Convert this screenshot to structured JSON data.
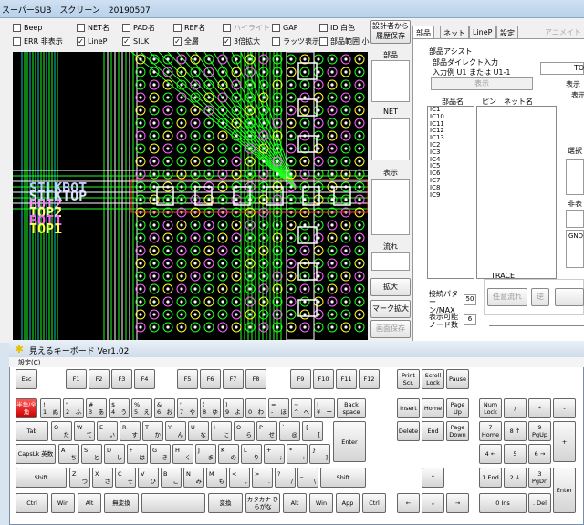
{
  "main": {
    "title": "スーパーSUB　スクリーン　20190507",
    "checkboxes": [
      {
        "label": "Beep",
        "checked": false,
        "dim": false
      },
      {
        "label": "NET名",
        "checked": false,
        "dim": false
      },
      {
        "label": "PAD名",
        "checked": false,
        "dim": false
      },
      {
        "label": "REF名",
        "checked": false,
        "dim": false
      },
      {
        "label": "ハイライト",
        "checked": false,
        "dim": true
      },
      {
        "label": "GAP",
        "checked": false,
        "dim": false
      },
      {
        "label": "ID 白色",
        "checked": false,
        "dim": false
      },
      {
        "label": "ERR 非表示",
        "checked": false,
        "dim": false
      },
      {
        "label": "LineP",
        "checked": true,
        "dim": false
      },
      {
        "label": "SILK",
        "checked": true,
        "dim": false
      },
      {
        "label": "全層",
        "checked": true,
        "dim": false
      },
      {
        "label": "3倍拡大",
        "checked": true,
        "dim": false
      },
      {
        "label": "ラッツ表示",
        "checked": false,
        "dim": false
      },
      {
        "label": "部品範囲 小",
        "checked": false,
        "dim": false
      }
    ],
    "side": {
      "design_btn": "設計者から\n履歴保存",
      "parts_lbl": "部品",
      "net_lbl": "NET",
      "display_lbl": "表示",
      "flow_lbl": "流れ",
      "zoom_btn": "拡大",
      "mark_btn": "マーク拡大",
      "screen_save_btn": "画面保存"
    },
    "tabs": [
      "部品",
      "ネット",
      "LineP",
      "設定",
      "アニメイト"
    ],
    "assist": {
      "header": "部品アシスト",
      "direct": "部品ダイレクト入力",
      "example": "入力例  U1  または  U1-1",
      "show_btn": "表示",
      "col_part": "部品名",
      "col_pin": "ピン",
      "col_net": "ネット名",
      "parts": [
        "IC1",
        "IC10",
        "IC11",
        "IC12",
        "IC13",
        "IC2",
        "IC3",
        "IC4",
        "IC5",
        "IC6",
        "IC7",
        "IC8",
        "IC9"
      ],
      "right_labels": [
        "TO",
        "表示",
        "表示",
        "選択",
        "非表",
        "GND"
      ],
      "pattern_lbl": "接続パターン/MAX",
      "pattern_val": "50",
      "node_lbl": "表示可能ノード数",
      "node_val": "6",
      "trace": "TRACE",
      "trace_flow_btn": "任意流れ",
      "trace_stop_btn": "逆"
    },
    "canvas_texts": [
      "SILKBOT",
      "SILKTOP",
      "BOT2",
      "TOP2",
      "BOT1",
      "TOP1"
    ]
  },
  "keyboard": {
    "title": "見えるキーボード Ver1.02",
    "menu": "設定(C)",
    "keys": {
      "esc": "Esc",
      "f1": "F1",
      "f2": "F2",
      "f3": "F3",
      "f4": "F4",
      "f5": "F5",
      "f6": "F6",
      "f7": "F7",
      "f8": "F8",
      "f9": "F9",
      "f10": "F10",
      "f11": "F11",
      "f12": "F12",
      "print": "Print Scr.",
      "scroll": "Scroll Lock",
      "pause": "Pause",
      "hankaku": "半角/全角",
      "back": "Back space",
      "insert": "Insert",
      "home": "Home",
      "pgup": "Page Up",
      "numlock": "Num Lock",
      "slash": "/",
      "star": "*",
      "minus": "-",
      "tab": "Tab",
      "enter": "Enter",
      "delete": "Delete",
      "end": "End",
      "pgdn": "Page Down",
      "n7": "7 Home",
      "n8": "8 ↑",
      "n9": "9 PgUp",
      "plus": "+",
      "caps": "CapsLk 英数",
      "n4": "4 ←",
      "n5": "5",
      "n6": "6 →",
      "shift_l": "Shift",
      "shift_r": "Shift",
      "up": "↑",
      "n1": "1 End",
      "n2": "2 ↓",
      "n3": "3 PgDn",
      "nenter": "Enter",
      "ctrl_l": "Ctrl",
      "win_l": "Win",
      "alt_l": "Alt",
      "muhenkan": "無変換",
      "henkan": "変換",
      "kana": "カタカナ ひらがな",
      "alt_r": "Alt",
      "win_r": "Win",
      "app": "App",
      "ctrl_r": "Ctrl",
      "left": "←",
      "down": "↓",
      "right": "→",
      "n0": "0 Ins",
      "ndot": ". Del"
    },
    "row1": [
      [
        "!",
        "1",
        "ぬ"
      ],
      [
        "\"",
        "2",
        "ふ"
      ],
      [
        "#",
        "3",
        "あ"
      ],
      [
        "$",
        "4",
        "う"
      ],
      [
        "%",
        "5",
        "え"
      ],
      [
        "&",
        "6",
        "お"
      ],
      [
        "'",
        "7",
        "や"
      ],
      [
        "(",
        "8",
        "ゆ"
      ],
      [
        ")",
        "9",
        "よ"
      ],
      [
        "",
        "0",
        "わ"
      ],
      [
        "=",
        "-",
        "ほ"
      ],
      [
        "~",
        "^",
        "へ"
      ],
      [
        "|",
        "¥",
        "ー"
      ]
    ],
    "row2": [
      [
        "Q",
        "た"
      ],
      [
        "W",
        "て"
      ],
      [
        "E",
        "い"
      ],
      [
        "R",
        "す"
      ],
      [
        "T",
        "か"
      ],
      [
        "Y",
        "ん"
      ],
      [
        "U",
        "な"
      ],
      [
        "I",
        "に"
      ],
      [
        "O",
        "ら"
      ],
      [
        "P",
        "せ"
      ],
      [
        "`",
        "@"
      ],
      [
        "{",
        "["
      ]
    ],
    "row3": [
      [
        "A",
        "ち"
      ],
      [
        "S",
        "と"
      ],
      [
        "D",
        "し"
      ],
      [
        "F",
        "は"
      ],
      [
        "G",
        "き"
      ],
      [
        "H",
        "く"
      ],
      [
        "J",
        "ま"
      ],
      [
        "K",
        "の"
      ],
      [
        "L",
        "り"
      ],
      [
        "+",
        ";"
      ],
      [
        "*",
        ":"
      ],
      [
        "}",
        "]"
      ]
    ],
    "row4": [
      [
        "Z",
        "つ"
      ],
      [
        "X",
        "さ"
      ],
      [
        "C",
        "そ"
      ],
      [
        "V",
        "ひ"
      ],
      [
        "B",
        "こ"
      ],
      [
        "N",
        "み"
      ],
      [
        "M",
        "も"
      ],
      [
        "<",
        ","
      ],
      [
        ">",
        "."
      ],
      [
        "?",
        "/"
      ],
      [
        "_",
        "\\"
      ]
    ]
  }
}
